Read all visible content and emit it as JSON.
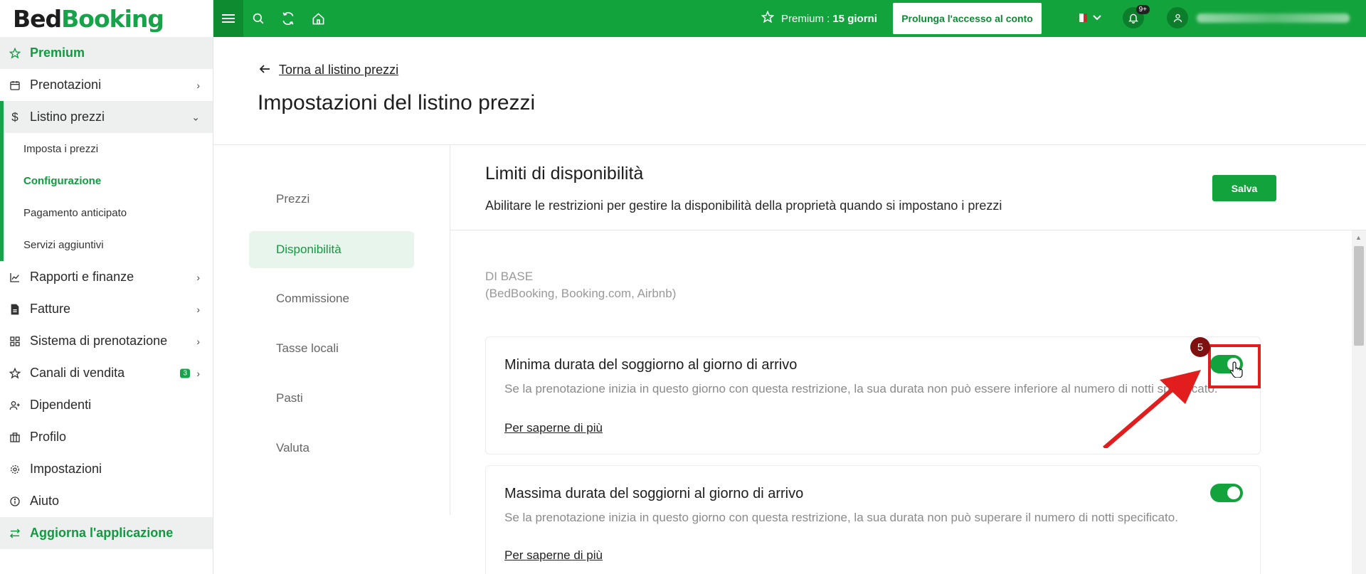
{
  "app": {
    "logo_part1": "Bed",
    "logo_part2": "Booking"
  },
  "sidebar": {
    "items": [
      {
        "label": "Premium"
      },
      {
        "label": "Prenotazioni"
      },
      {
        "label": "Listino prezzi"
      },
      {
        "label": "Rapporti e finanze"
      },
      {
        "label": "Fatture"
      },
      {
        "label": "Sistema di prenotazione"
      },
      {
        "label": "Canali di vendita",
        "badge": "3"
      },
      {
        "label": "Dipendenti"
      },
      {
        "label": "Profilo"
      },
      {
        "label": "Impostazioni"
      },
      {
        "label": "Aiuto"
      },
      {
        "label": "Aggiorna l'applicazione"
      }
    ],
    "submenu": [
      {
        "label": "Imposta i prezzi"
      },
      {
        "label": "Configurazione"
      },
      {
        "label": "Pagamento anticipato"
      },
      {
        "label": "Servizi aggiuntivi"
      }
    ]
  },
  "topbar": {
    "premium_label": "Premium :",
    "premium_days": "15 giorni",
    "extend_button": "Prolunga l'accesso al conto",
    "notifications_badge": "9+"
  },
  "header": {
    "back_link": "Torna al listino prezzi",
    "title": "Impostazioni del listino prezzi"
  },
  "tabs": [
    {
      "label": "Prezzi"
    },
    {
      "label": "Disponibilità"
    },
    {
      "label": "Commissione"
    },
    {
      "label": "Tasse locali"
    },
    {
      "label": "Pasti"
    },
    {
      "label": "Valuta"
    }
  ],
  "section": {
    "title": "Limiti di disponibilità",
    "description": "Abilitare le restrizioni per gestire la disponibilità della proprietà quando si impostano i prezzi",
    "save_button": "Salva",
    "group_label_1": "DI BASE",
    "group_label_2": "(BedBooking, Booking.com, Airbnb)"
  },
  "cards": [
    {
      "title": "Minima durata del soggiorno al giorno di arrivo",
      "description": "Se la prenotazione inizia in questo giorno con questa restrizione, la sua durata non può essere inferiore al numero di notti specificato.",
      "link": "Per saperne di più",
      "enabled": true
    },
    {
      "title": "Massima durata del soggiorni al giorno di arrivo",
      "description": "Se la prenotazione inizia in questo giorno con questa restrizione, la sua durata non può superare il numero di notti specificato.",
      "link": "Per saperne di più",
      "enabled": true
    }
  ],
  "annotation": {
    "step": "5"
  },
  "colors": {
    "brand_green": "#13a33c",
    "annotation_red": "#e11d1d"
  }
}
